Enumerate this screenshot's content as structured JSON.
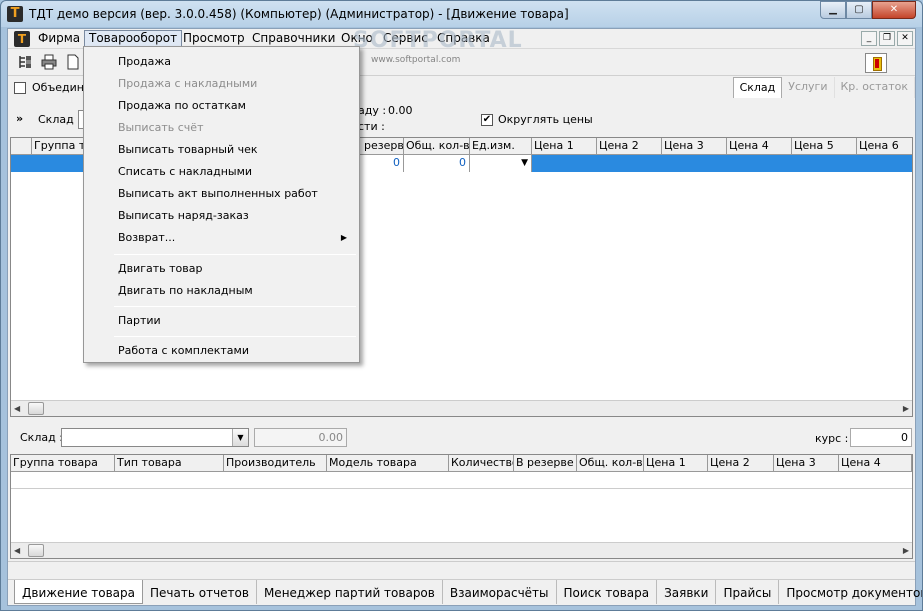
{
  "window": {
    "title": "ТДТ демо версия (вер. 3.0.0.458) (Компьютер) (Администратор) - [Движение товара]",
    "icon_letter": "Т",
    "controls": {
      "minimize": "▁",
      "maximize": "▢",
      "close": "✕"
    }
  },
  "menubar": {
    "icon_letter": "Т",
    "items": [
      "Фирма",
      "Товарооборот",
      "Просмотр",
      "Справочники",
      "Окно",
      "Сервис",
      "Справка"
    ],
    "mdi_controls": {
      "minimize": "_",
      "restore": "❐",
      "close": "✕"
    }
  },
  "toolbar": {
    "icons": [
      "tree-icon",
      "printer-icon",
      "document-icon",
      "exit-door-icon"
    ]
  },
  "options": {
    "combine_label": "Объедини",
    "combine_checked": false,
    "round_prices_label": "Округлять цены",
    "round_prices_checked": true,
    "check_mark": "✔",
    "ware_label_partial": "аду :",
    "ware_value": "0.00",
    "cost_label_partial": "сти :",
    "right_tabs": [
      "Склад",
      "Услуги",
      "Кр. остаток"
    ],
    "right_tab_active": "Склад"
  },
  "filter": {
    "expand_glyph": "»",
    "warehouse_label": "Склад :"
  },
  "upper_grid": {
    "columns": [
      "",
      "Группа то",
      "В резерве",
      "Общ. кол-во",
      "Ед.изм.",
      "Цена 1",
      "Цена 2",
      "Цена 3",
      "Цена 4",
      "Цена 5",
      "Цена 6"
    ],
    "selected_row": {
      "reserve": "0",
      "total": "0",
      "unit_dropdown": "▼"
    }
  },
  "lower_panel": {
    "warehouse_label": "Склад :",
    "warehouse_value": "",
    "amount_value": "0.00",
    "rate_label": "курс :",
    "rate_value": "0",
    "columns": [
      "Группа товара",
      "Тип товара",
      "Производитель",
      "Модель товара",
      "Количество",
      "В резерве",
      "Общ. кол-во",
      "Цена 1",
      "Цена 2",
      "Цена 3",
      "Цена 4"
    ]
  },
  "bottom_tabs": [
    "Движение товара",
    "Печать отчетов",
    "Менеджер партий товаров",
    "Взаиморасчёты",
    "Поиск товара",
    "Заявки",
    "Прайсы",
    "Просмотр документов"
  ],
  "bottom_tab_active": "Движение товара",
  "dropdown_menu": {
    "parent": "Товарооборот",
    "items": [
      {
        "label": "Продажа",
        "enabled": true
      },
      {
        "label": "Продажа с накладными",
        "enabled": false
      },
      {
        "label": "Продажа по остаткам",
        "enabled": true
      },
      {
        "label": "Выписать счёт",
        "enabled": false
      },
      {
        "label": "Выписать товарный чек",
        "enabled": true
      },
      {
        "label": "Списать с накладными",
        "enabled": true
      },
      {
        "label": "Выписать акт выполненных работ",
        "enabled": true
      },
      {
        "label": "Выписать наряд-заказ",
        "enabled": true
      },
      {
        "label": "Возврат...",
        "enabled": true,
        "submenu": true
      },
      {
        "label": "Двигать товар",
        "enabled": true
      },
      {
        "label": "Двигать по накладным",
        "enabled": true
      },
      {
        "label": "Партии",
        "enabled": true
      },
      {
        "label": "Работа с комплектами",
        "enabled": true
      }
    ],
    "submenu_arrow": "▶"
  },
  "watermark": {
    "big": "SOFTPORTAL",
    "small": "www.softportal.com"
  },
  "scroll": {
    "left": "◀",
    "right": "▶"
  },
  "colors": {
    "selection": "#2a8ae0",
    "title_gradient_top": "#cfe1f1",
    "close_button": "#c4442a"
  }
}
